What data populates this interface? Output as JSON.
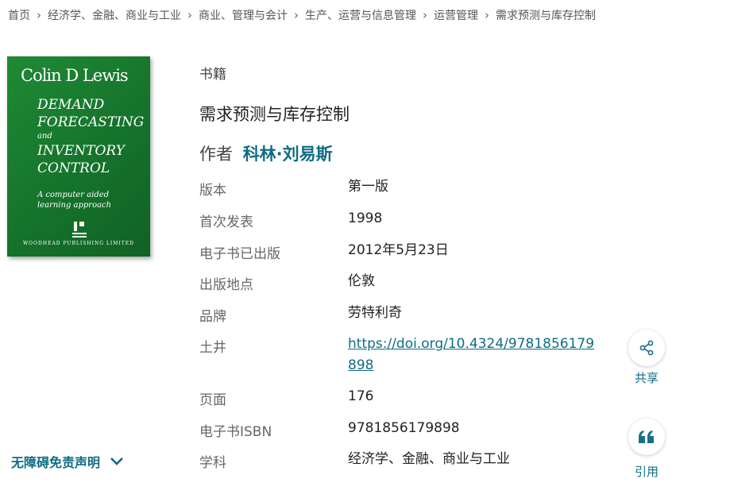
{
  "breadcrumb": [
    {
      "label": "首页"
    },
    {
      "label": "经济学、金融、商业与工业"
    },
    {
      "label": "商业、管理与会计"
    },
    {
      "label": "生产、运营与信息管理"
    },
    {
      "label": "运营管理"
    },
    {
      "label": "需求预测与库存控制"
    }
  ],
  "cover": {
    "author": "Colin D Lewis",
    "title_line1": "DEMAND",
    "title_line2": "FORECASTING",
    "title_and": "and",
    "title_line3": "INVENTORY",
    "title_line4": "CONTROL",
    "subtitle_line1": "A computer aided",
    "subtitle_line2": "learning approach",
    "publisher": "WOODHEAD PUBLISHING LIMITED"
  },
  "book": {
    "type_label": "书籍",
    "title": "需求预测与库存控制",
    "author_prefix": "作者",
    "author_name": "科林·刘易斯"
  },
  "meta": [
    {
      "label": "版本",
      "value": "第一版"
    },
    {
      "label": "首次发表",
      "value": "1998"
    },
    {
      "label": "电子书已出版",
      "value": "2012年5月23日"
    },
    {
      "label": "出版地点",
      "value": "伦敦"
    },
    {
      "label": "品牌",
      "value": "劳特利奇"
    },
    {
      "label": "土井",
      "value": "https://doi.org/10.4324/9781856179898",
      "is_link": true
    },
    {
      "label": "页面",
      "value": "176"
    },
    {
      "label": "电子书ISBN",
      "value": "9781856179898"
    },
    {
      "label": "学科",
      "value": "经济学、金融、商业与工业"
    }
  ],
  "actions": {
    "share_label": "共享",
    "share_icon": "share-icon",
    "cite_label": "引用",
    "cite_icon": "quote-icon"
  },
  "accessibility": {
    "label": "无障碍免责声明",
    "icon": "chevron-down-icon"
  },
  "colors": {
    "accent": "#0f6c83",
    "cover_green": "#1a7f32"
  }
}
